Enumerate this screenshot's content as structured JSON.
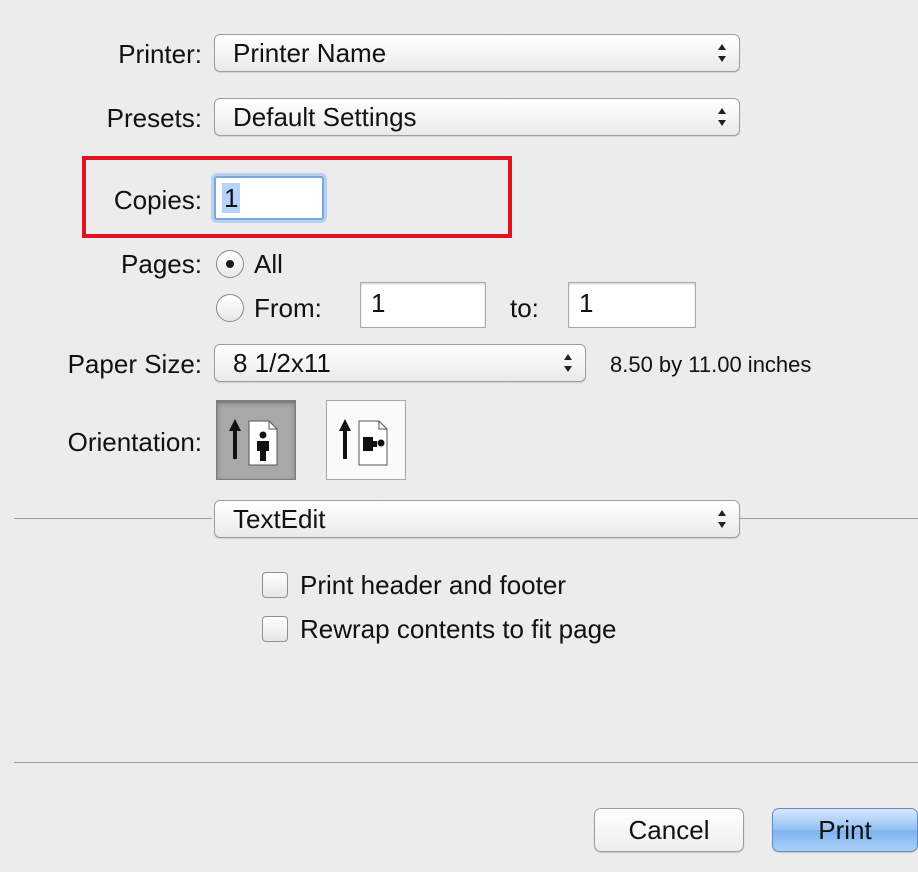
{
  "printer": {
    "label": "Printer:",
    "value": "Printer Name"
  },
  "presets": {
    "label": "Presets:",
    "value": "Default Settings"
  },
  "copies": {
    "label": "Copies:",
    "value": "1"
  },
  "pages": {
    "label": "Pages:",
    "all_label": "All",
    "from_label": "From:",
    "from_value": "1",
    "to_label": "to:",
    "to_value": "1",
    "selected": "All"
  },
  "paper_size": {
    "label": "Paper Size:",
    "value": "8 1/2x11",
    "dimensions": "8.50 by 11.00 inches"
  },
  "orientation": {
    "label": "Orientation:",
    "selected": "portrait"
  },
  "section": {
    "value": "TextEdit"
  },
  "options": [
    {
      "label": "Print header and footer",
      "checked": false
    },
    {
      "label": "Rewrap contents to fit page",
      "checked": false
    }
  ],
  "buttons": {
    "cancel": "Cancel",
    "print": "Print"
  },
  "colors": {
    "highlight": "#e0141e",
    "focus_ring": "#7ba7e1",
    "default_button": "#7fb2ef"
  }
}
